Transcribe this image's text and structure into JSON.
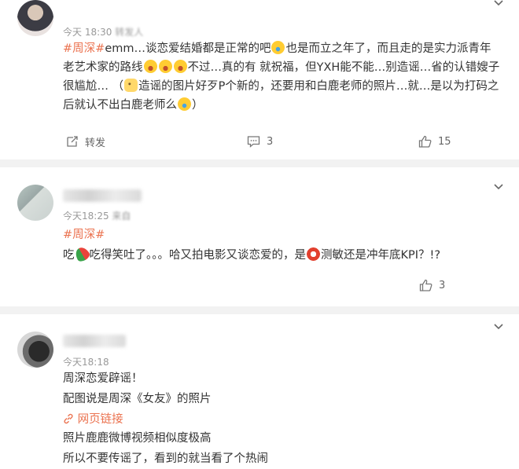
{
  "comments": [
    {
      "time": "今天 18:30",
      "source": "转发人",
      "text": {
        "tag": "#周深#",
        "p1": "emm…谈恋爱结婚都是正常的吧",
        "p2": "也是而立之年了，而且走的是实力派青年老艺术家的路线",
        "p3": "不过…真的有 就祝福，但YXH能不能…别造谣…省的认错嫂子很尴尬… （",
        "p4": "造谣的图片好歹P个新的，还要用和白鹿老师的照片…就…是以为打码之后就认不出白鹿老师么",
        "p5": "）"
      },
      "actions": {
        "repost": "转发",
        "comments": "3",
        "likes": "15"
      }
    },
    {
      "time": "今天18:25",
      "source": "来自",
      "text": {
        "tag": "#周深#",
        "p1": "吃",
        "p2": "吃得笑吐了。。。哈又拍电影又谈恋爱的，是",
        "p3": "测敏还是冲年底KPI？!?"
      },
      "actions": {
        "likes": "3"
      }
    },
    {
      "time": "今天18:18",
      "lines": [
        "周深恋爱辟谣！",
        "配图说是周深《女友》的照片"
      ],
      "link": "网页链接",
      "lines2": [
        "照片鹿鹿微博视频相似度极高",
        "所以不要传谣了，看到的就当看了个热闹"
      ]
    }
  ],
  "icons": {
    "chevron": "chevron-down-icon",
    "repost": "repost-icon",
    "comment": "comment-icon",
    "like": "like-icon",
    "link": "link-icon"
  },
  "colors": {
    "accent": "#eb7350",
    "text": "#333333",
    "meta": "#999999",
    "divider": "#f2f2f2"
  }
}
